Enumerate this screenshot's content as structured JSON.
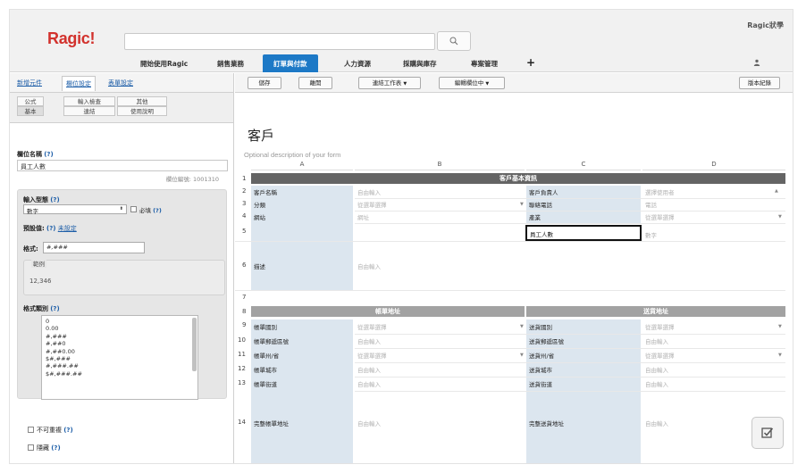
{
  "header": {
    "logo": "Ragic!",
    "user_link": "Ragic狀學",
    "search_placeholder": ""
  },
  "nav": {
    "items": [
      "開始使用Ragic",
      "銷售業務",
      "訂單與付款",
      "人力資源",
      "採購與庫存",
      "專案管理"
    ],
    "active_index": 2,
    "plus": "+"
  },
  "left_panel": {
    "tabs": [
      "新增元件",
      "欄位設定",
      "表單設定"
    ],
    "active_tab": 1,
    "subtabs_row1": [
      "公式",
      "輸入檢查",
      "其他"
    ],
    "subtabs_row2": [
      "基本",
      "連結",
      "使用說明"
    ],
    "field_name_label": "欄位名稱",
    "help_mark": "(?)",
    "field_name_value": "員工人數",
    "field_id": "欄位編號: 1001310",
    "input_type_label": "輸入型態",
    "input_type_value": "數字",
    "required_label": "必填",
    "default_label": "預設值:",
    "default_value": "未設定",
    "format_label": "格式:",
    "format_value": "#,###",
    "example_label": "範例",
    "example_value": "12,346",
    "format_category_label": "格式類別",
    "format_options": [
      "0",
      "0.00",
      "#,###",
      "#,##0",
      "#,##0.00",
      "$#,###",
      "#,###.##",
      "$#,###.##"
    ],
    "unique_label": "不可重複",
    "hidden_label": "隱藏"
  },
  "toolbar": {
    "save": "儲存",
    "leave": "離開",
    "link_sheet": "連結工作表",
    "editing_fields": "編輯欄位中",
    "version_history": "版本紀錄",
    "caret": "▼"
  },
  "form": {
    "title": "客戶",
    "description": "Optional description of your form",
    "columns": [
      "A",
      "B",
      "C",
      "D"
    ],
    "section_customer": "客戶基本資訊",
    "section_billing": "帳單地址",
    "section_shipping": "送貨地址",
    "rows": [
      {
        "n": "1"
      },
      {
        "n": "2",
        "a": "客戶名稱",
        "b": "自由輸入",
        "c": "客戶負責人",
        "d": "選擇使用者"
      },
      {
        "n": "3",
        "a": "分類",
        "b": "從選單選擇",
        "c": "聯絡電話",
        "d": "電話"
      },
      {
        "n": "4",
        "a": "網站",
        "b": "網址",
        "c": "產業",
        "d": "從選單選擇"
      },
      {
        "n": "5",
        "c": "員工人數",
        "d": "數字"
      },
      {
        "n": "6",
        "a": "描述",
        "b": "自由輸入"
      },
      {
        "n": "7"
      },
      {
        "n": "8"
      },
      {
        "n": "9",
        "a": "帳單國別",
        "b": "從選單選擇",
        "c": "送貨國別",
        "d": "從選單選擇"
      },
      {
        "n": "10",
        "a": "帳單郵遞區號",
        "b": "自由輸入",
        "c": "送貨郵遞區號",
        "d": "自由輸入"
      },
      {
        "n": "11",
        "a": "帳單州/省",
        "b": "從選單選擇",
        "c": "送貨州/省",
        "d": "從選單選擇"
      },
      {
        "n": "12",
        "a": "帳單城市",
        "b": "自由輸入",
        "c": "送貨城市",
        "d": "自由輸入"
      },
      {
        "n": "13",
        "a": "帳單街道",
        "b": "自由輸入",
        "c": "送貨街道",
        "d": "自由輸入"
      },
      {
        "n": "14",
        "a": "完整帳單地址",
        "b": "自由輸入",
        "c": "完整送貨地址",
        "d": "自由輸入"
      }
    ]
  },
  "colors": {
    "brand_red": "#d2322d",
    "nav_active": "#1d79c6",
    "section_dark": "#646464",
    "section_light": "#a2a2a2",
    "label_col": "#dce6ef"
  }
}
